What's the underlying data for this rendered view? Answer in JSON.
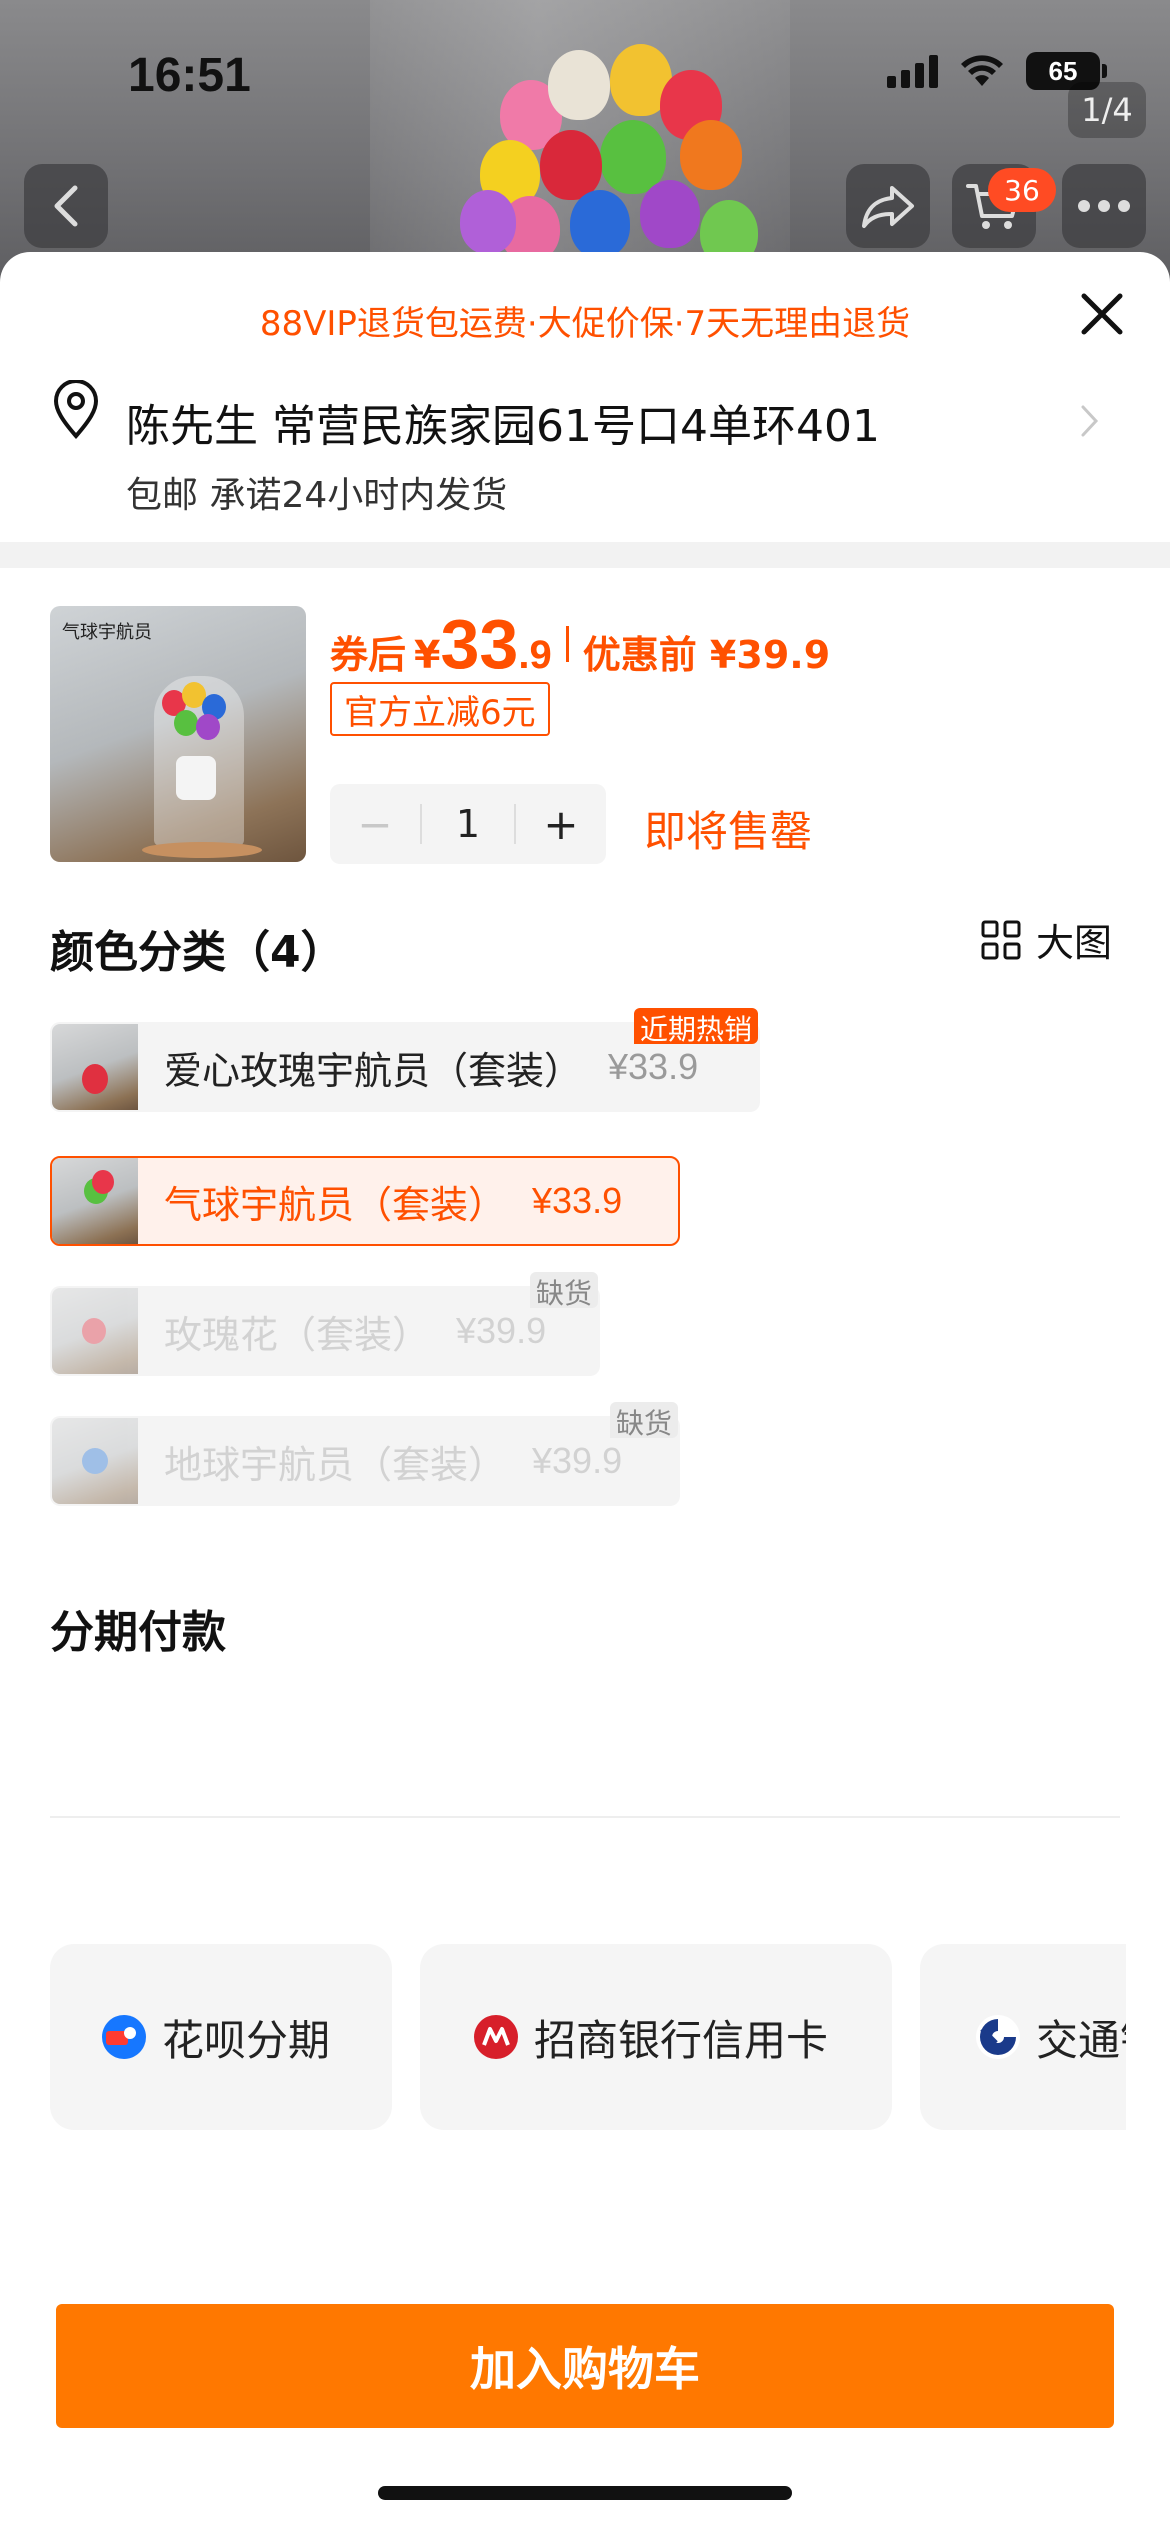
{
  "status_bar": {
    "time": "16:51",
    "battery": "65"
  },
  "gallery": {
    "page_indicator": "1/4",
    "cart_count": "36"
  },
  "sheet": {
    "vip_banner": "88VIP退货包运费·大促价保·7天无理由退货",
    "address": {
      "line": "陈先生 常营民族家园61号口4单环401",
      "shipping": "包邮 承诺24小时内发货"
    },
    "product": {
      "thumb_title": "气球宇航员",
      "price_label": "券后",
      "price_symbol": "¥",
      "price_integer": "33",
      "price_decimal": ".9",
      "price_before": "优惠前 ¥39.9",
      "coupon": "官方立减6元",
      "quantity": "1",
      "stock_note": "即将售罄"
    },
    "color_section": {
      "title": "颜色分类（4）",
      "big_view": "大图",
      "options": [
        {
          "name": "爱心玫瑰宇航员（套装）",
          "price": "¥33.9",
          "tag": "近期热销"
        },
        {
          "name": "气球宇航员（套装）",
          "price": "¥33.9",
          "tag": ""
        },
        {
          "name": "玫瑰花（套装）",
          "price": "¥39.9",
          "tag": "缺货"
        },
        {
          "name": "地球宇航员（套装）",
          "price": "¥39.9",
          "tag": "缺货"
        }
      ]
    },
    "installment": {
      "title": "分期付款",
      "options": [
        {
          "label": "花呗分期"
        },
        {
          "label": "招商银行信用卡"
        },
        {
          "label": "交通银"
        }
      ]
    },
    "add_to_cart": "加入购物车"
  },
  "colors": {
    "accent": "#ff5000",
    "button": "#ff7800"
  }
}
